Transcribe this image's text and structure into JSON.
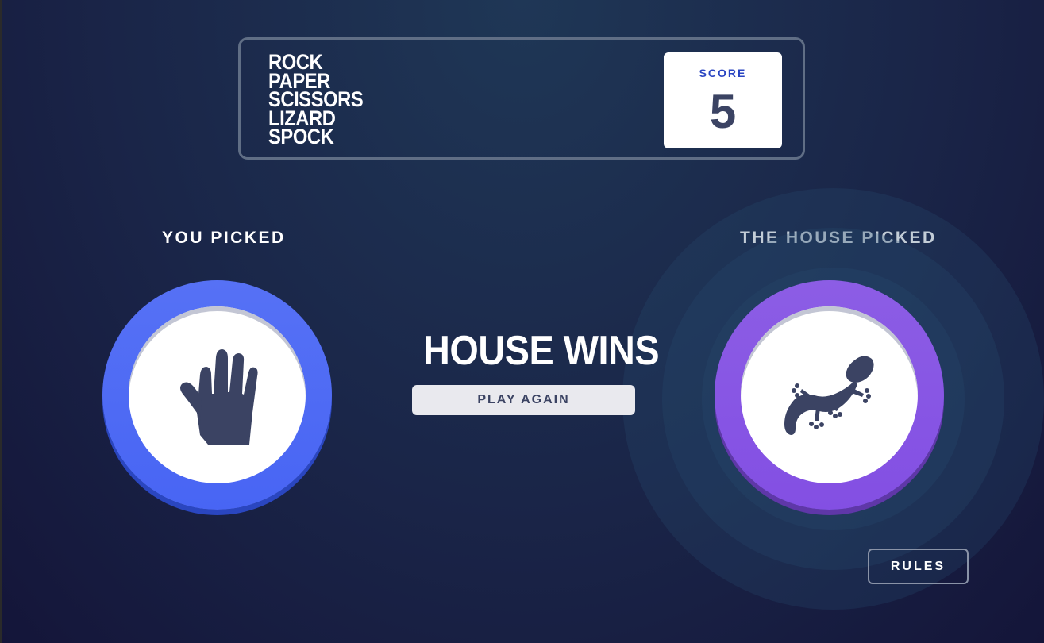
{
  "header": {
    "title_lines": [
      "ROCK",
      "PAPER",
      "SCISSORS",
      "LIZARD",
      "SPOCK"
    ],
    "score_label": "SCORE",
    "score_value": "5"
  },
  "player": {
    "label": "YOU PICKED",
    "choice_icon": "paper-hand-icon",
    "ring_color": "#4865f4"
  },
  "house": {
    "label": "THE HOUSE PICKED",
    "choice_icon": "lizard-icon",
    "ring_color": "#834fe3",
    "winner_highlight": true
  },
  "result": {
    "text": "HOUSE WINS",
    "play_again_label": "PLAY AGAIN"
  },
  "rules_label": "RULES",
  "colors": {
    "icon_color": "#3b4363",
    "score_label_color": "#2a45c2"
  }
}
